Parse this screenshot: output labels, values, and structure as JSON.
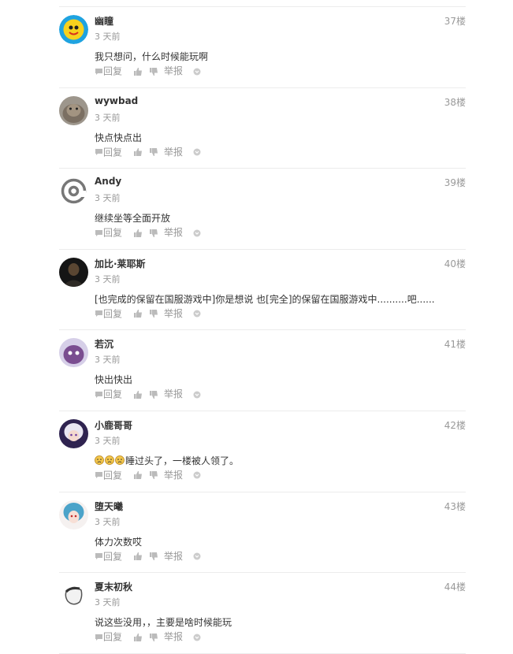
{
  "labels": {
    "reply": "回复",
    "report": "举报"
  },
  "comments": [
    {
      "avatar": "avatar-qq-mascot",
      "user": "幽瞳",
      "time": "3 天前",
      "floor": "37楼",
      "text": "我只想问，什么时候能玩啊"
    },
    {
      "avatar": "avatar-animal-photo",
      "user": "wywbad",
      "time": "3 天前",
      "floor": "38楼",
      "text": "快点快点出"
    },
    {
      "avatar": "avatar-at-symbol",
      "user": "Andy",
      "time": "3 天前",
      "floor": "39楼",
      "text": "继续坐等全面开放"
    },
    {
      "avatar": "avatar-dark-figure",
      "user": "加比·莱耶斯",
      "time": "3 天前",
      "floor": "40楼",
      "text": "[也完成的保留在国服游戏中]你是想说 也[完全]的保留在国服游戏中..........吧......"
    },
    {
      "avatar": "avatar-purple-character",
      "user": "若沉",
      "time": "3 天前",
      "floor": "41楼",
      "text": "快出快出"
    },
    {
      "avatar": "avatar-anime-white-hair",
      "user": "小鹿哥哥",
      "time": "3 天前",
      "floor": "42楼",
      "emoji": [
        "sad-face-emoji",
        "sad-face-emoji",
        "sad-face-emoji"
      ],
      "text": "睡过头了，一楼被人领了。"
    },
    {
      "avatar": "avatar-anime-blue-hair",
      "user": "堕天曦",
      "time": "3 天前",
      "floor": "43楼",
      "text": "体力次数哎"
    },
    {
      "avatar": "avatar-sketch-face",
      "user": "夏末初秋",
      "time": "3 天前",
      "floor": "44楼",
      "text": "说这些没用，，主要是啥时候能玩"
    }
  ]
}
